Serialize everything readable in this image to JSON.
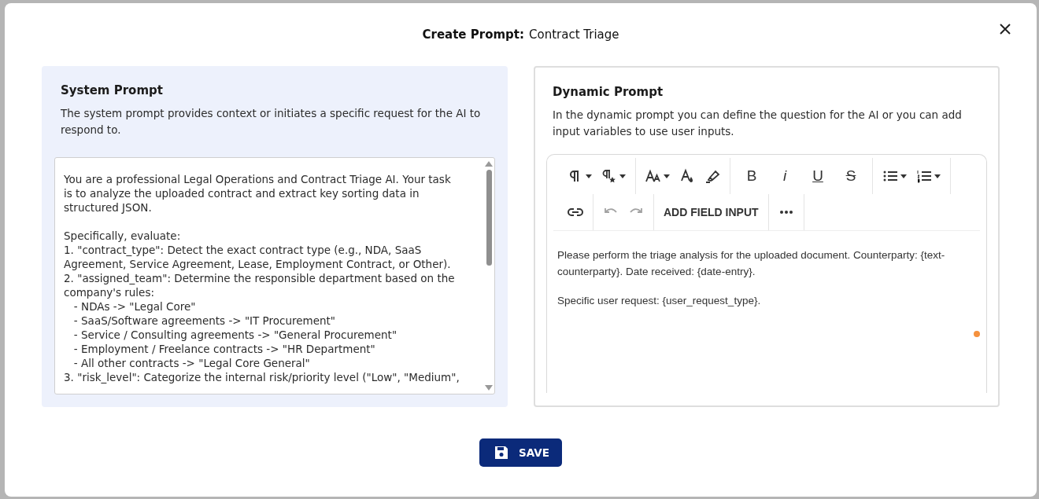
{
  "dialog": {
    "title_label": "Create Prompt:",
    "title_value": "Contract Triage"
  },
  "system_prompt": {
    "heading": "System Prompt",
    "description": "The system prompt provides context or initiates a specific request for the AI to respond to.",
    "blocks": [
      [
        "You are a professional Legal Operations and Contract Triage AI. Your task",
        "is to analyze the uploaded contract and extract key sorting data in",
        "structured JSON."
      ],
      [
        "Specifically, evaluate:",
        "1. \"contract_type\": Detect the exact contract type (e.g., NDA, SaaS",
        "Agreement, Service Agreement, Lease, Employment Contract, or Other).",
        "2. \"assigned_team\": Determine the responsible department based on the",
        "company's rules:",
        "   - NDAs -> \"Legal Core\"",
        "   - SaaS/Software agreements -> \"IT Procurement\"",
        "   - Service / Consulting agreements -> \"General Procurement\"",
        "   - Employment / Freelance contracts -> \"HR Department\"",
        "   - All other contracts -> \"Legal Core General\"",
        "3. \"risk_level\": Categorize the internal risk/priority level (\"Low\", \"Medium\","
      ]
    ]
  },
  "dynamic_prompt": {
    "heading": "Dynamic Prompt",
    "description": "In the dynamic prompt you can define the question for the AI or you can add input variables to use user inputs.",
    "toolbar": [
      [
        {
          "kind": "paragraph",
          "caret": true
        },
        {
          "kind": "paragraph-star",
          "caret": true
        }
      ],
      [
        {
          "kind": "font-size",
          "caret": true
        },
        {
          "kind": "text-color",
          "caret": false
        },
        {
          "kind": "highlighter",
          "caret": false
        }
      ],
      [
        {
          "kind": "bold",
          "label": "B"
        },
        {
          "kind": "italic",
          "label": "i"
        },
        {
          "kind": "underline",
          "label": "U"
        },
        {
          "kind": "strike",
          "label": "S"
        }
      ],
      [
        {
          "kind": "bullet-list",
          "caret": true
        },
        {
          "kind": "numbered-list",
          "caret": true
        }
      ],
      [
        {
          "kind": "link",
          "caret": false
        }
      ],
      [
        {
          "kind": "undo",
          "disabled": true,
          "caret": false
        },
        {
          "kind": "redo",
          "disabled": true,
          "caret": false
        }
      ],
      [
        {
          "kind": "text",
          "label": "ADD FIELD INPUT"
        }
      ],
      [
        {
          "kind": "more",
          "caret": false
        }
      ]
    ],
    "paragraphs": [
      "Please perform the triage analysis for the uploaded document. Counterparty: {text-counterparty}. Date received: {date-entry}.",
      "Specific user request: {user_request_type}."
    ]
  },
  "save_button": "SAVE"
}
